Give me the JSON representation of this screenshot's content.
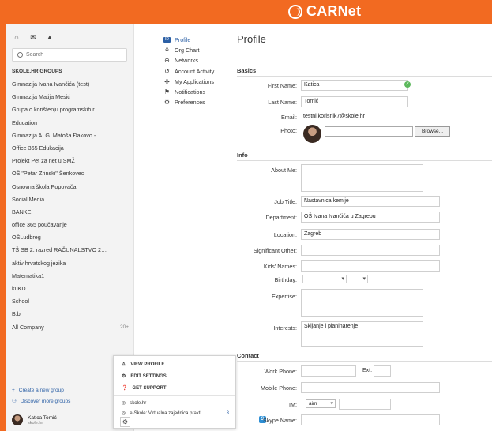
{
  "brand": {
    "name": "CARNet"
  },
  "sidebar": {
    "more_label": "…",
    "search_placeholder": "Search",
    "groups_heading": "SKOLE.HR GROUPS",
    "groups": [
      "Gimnazija Ivana Ivančića (test)",
      "Gimnazija Matija Mesić",
      "Grupa o korištenju programskih r…",
      "Education",
      "Gimnazija A. G. Matoša Đakovo -…",
      "Office 365 Edukacija",
      "Projekt Pet za net u SMŽ",
      "OŠ \"Petar Zrinski\" Šenkovec",
      "Osnovna škola Popovača",
      "Social Media",
      "BANKE",
      "office 365 poučavanje",
      "OŠLudbreg",
      "TŠ SB 2. razred RAČUNALSTVO 2…",
      "aktiv hrvatskog jezika",
      "Matematika1",
      "kuKD",
      "School",
      "B.b",
      "All Company"
    ],
    "all_company_count": "20+",
    "create_group": "Create a new group",
    "discover_groups": "Discover more groups",
    "user_name": "Katica Tomić",
    "user_domain": "skole.hr"
  },
  "popup": {
    "view_profile": "VIEW PROFILE",
    "edit_settings": "EDIT SETTINGS",
    "get_support": "GET SUPPORT",
    "network_1": "skole.hr",
    "network_2": "e-Škole: Virtualna zajednica prakti…",
    "network_2_count": "3"
  },
  "profile_nav": {
    "profile": "Profile",
    "org_chart": "Org Chart",
    "networks": "Networks",
    "account_activity": "Account Activity",
    "my_applications": "My Applications",
    "notifications": "Notifications",
    "preferences": "Preferences"
  },
  "main": {
    "title": "Profile",
    "basics_heading": "Basics",
    "first_name_label": "First Name:",
    "first_name": "Katica",
    "last_name_label": "Last Name:",
    "last_name": "Tomić",
    "email_label": "Email:",
    "email": "testni.korisnik7@skole.hr",
    "photo_label": "Photo:",
    "browse_label": "Browse...",
    "info_heading": "Info",
    "about_me_label": "About Me:",
    "about_me": "",
    "job_title_label": "Job Title:",
    "job_title": "Nastavnica kemije",
    "department_label": "Department:",
    "department": "OŠ Ivana Ivančića u Zagrebu",
    "location_label": "Location:",
    "location": "Zagreb",
    "significant_other_label": "Significant Other:",
    "significant_other": "",
    "kids_names_label": "Kids' Names:",
    "kids_names": "",
    "birthday_label": "Birthday:",
    "expertise_label": "Expertise:",
    "expertise": "",
    "interests_label": "Interests:",
    "interests": "Skijanje i planinarenje",
    "contact_heading": "Contact",
    "work_phone_label": "Work Phone:",
    "ext_label": "Ext.",
    "mobile_phone_label": "Mobile Phone:",
    "im_label": "IM:",
    "im_service": "aim",
    "skype_label": "Skype Name:"
  }
}
